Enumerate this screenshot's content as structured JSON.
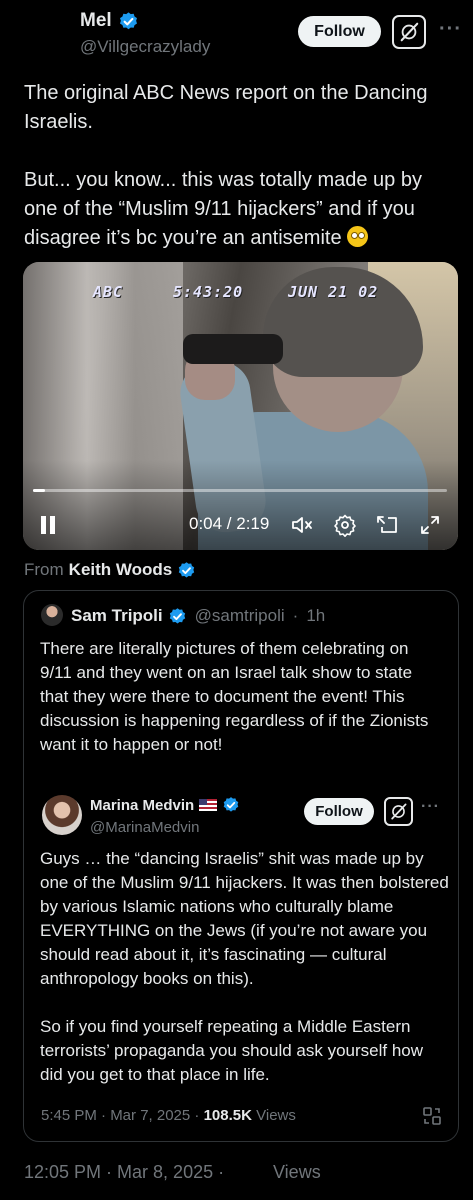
{
  "post": {
    "author": {
      "name": "Mel",
      "handle": "@Villgecrazylady",
      "verified": true
    },
    "follow_label": "Follow",
    "text_lines": [
      "The original ABC News report on the Dancing",
      "Israelis.",
      "But... you know... this was totally made up by",
      "one of the “Muslim 9/11 hijackers” and if you",
      "disagree it’s bc you’re an antisemite"
    ],
    "emoji": "face-with-rolling-eyes",
    "video": {
      "osd_station": "ABC",
      "osd_time": "5:43:20",
      "osd_date": "JUN 21 02",
      "time_display": "0:04 / 2:19",
      "progress": 0.03
    },
    "from_label": "From",
    "from_name": "Keith Woods",
    "timestamp": "12:05 PM · Mar 8, 2025 ·",
    "views_label": "Views"
  },
  "quote": {
    "author": {
      "name": "Sam Tripoli",
      "handle": "@samtripoli",
      "age": "1h"
    },
    "separator": "·",
    "text": "There are literally pictures of them celebrating on 9/11 and they went on an Israel talk show to state that they were there to document the event! This discussion is happening regardless of if the Zionists want it to happen or not!",
    "nested": {
      "author": {
        "name": "Marina Medvin",
        "handle": "@MarinaMedvin"
      },
      "follow_label": "Follow",
      "paragraphs": [
        "Guys … the “dancing Israelis” shit was made up by one of the Muslim 9/11 hijackers. It was then bolstered by various Islamic nations who culturally blame EVERYTHING on the Jews (if you’re not aware you should read about it, it’s fascinating — cultural anthropology books on this).",
        "So if you find yourself repeating a Middle Eastern terrorists’ propaganda you should ask yourself how did you get to that place in life."
      ],
      "timestamp": "5:45 PM · Mar 7, 2025 ·",
      "views_count": "108.5K",
      "views_label": "Views"
    }
  },
  "colors": {
    "verified_blue": "#1d9bf0",
    "text_primary": "#e7e9ea",
    "text_secondary": "#71767b",
    "border": "#2f3336",
    "background": "#000000"
  }
}
